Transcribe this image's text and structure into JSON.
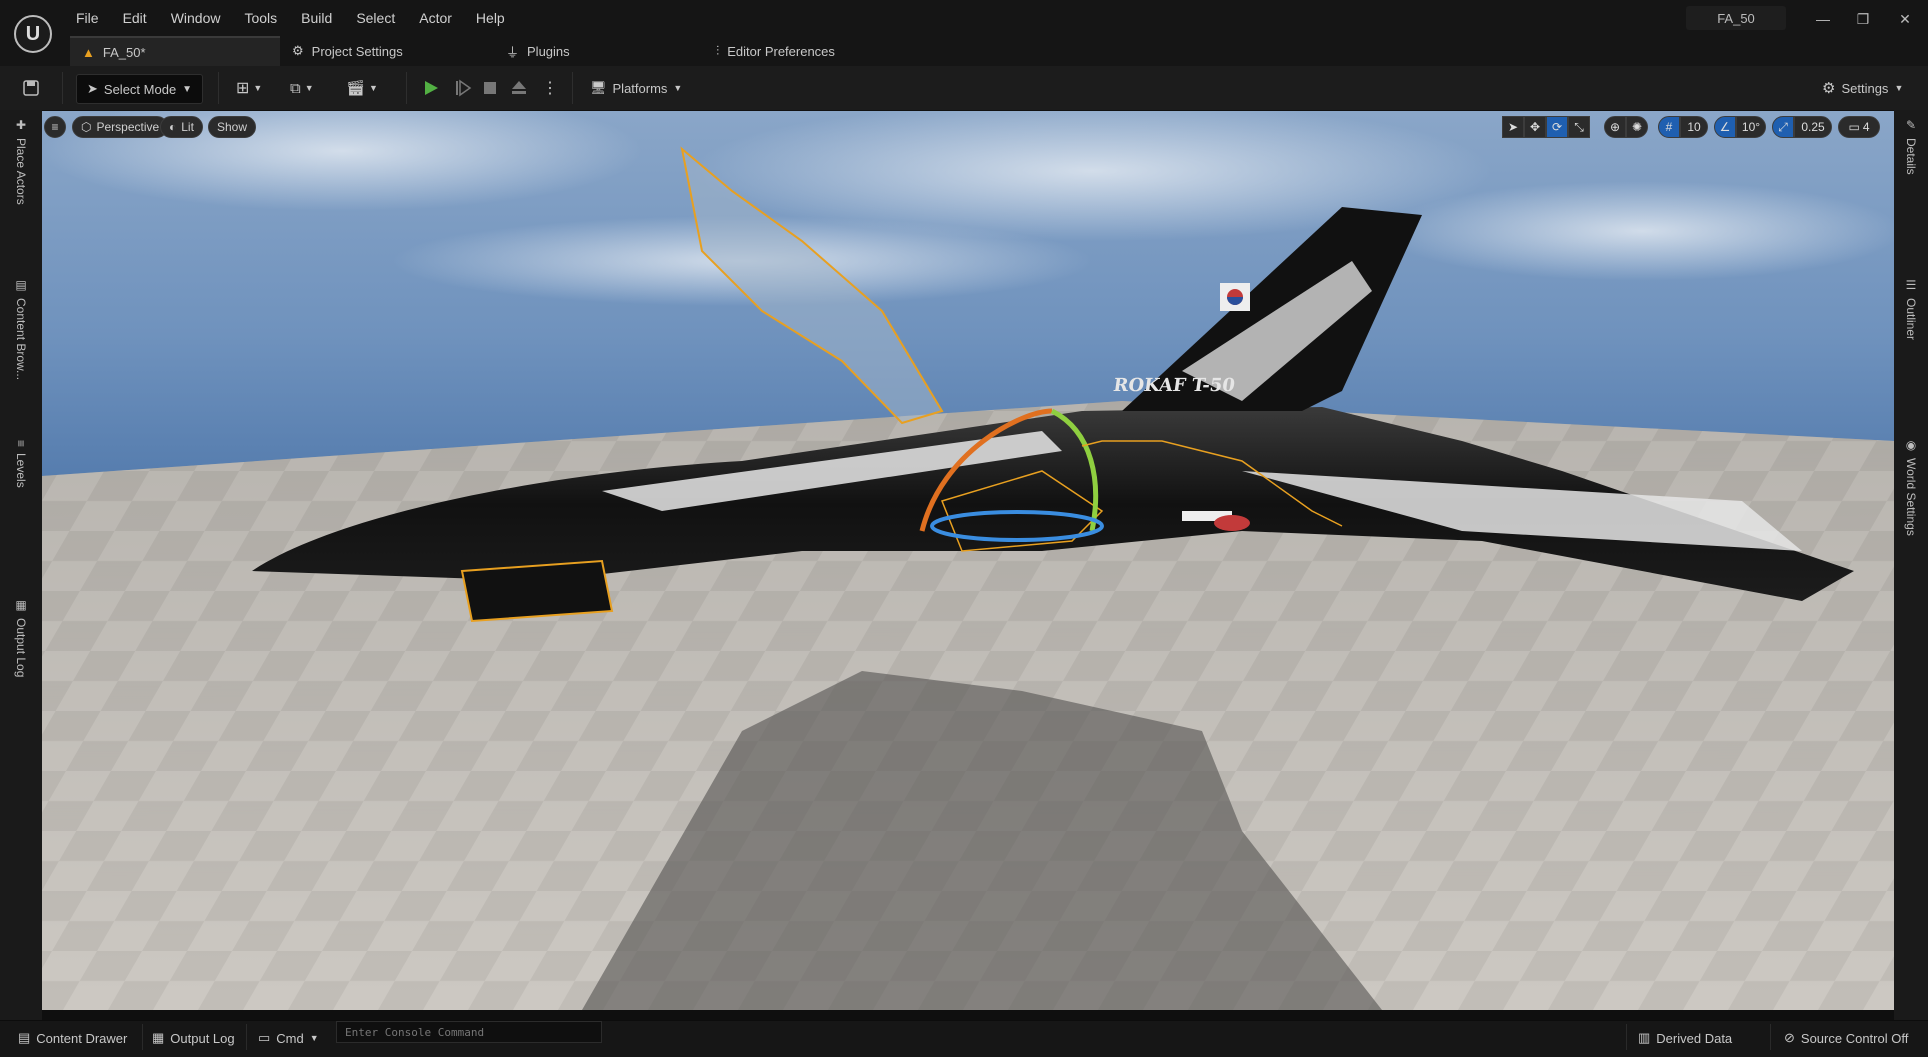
{
  "app": {
    "logo_glyph": "U",
    "project_label": "FA_50"
  },
  "menu": [
    "File",
    "Edit",
    "Window",
    "Tools",
    "Build",
    "Select",
    "Actor",
    "Help"
  ],
  "window_controls": {
    "minimize": "—",
    "restore": "❐",
    "close": "✕"
  },
  "tabs": [
    {
      "label": "FA_50*",
      "icon": "level-warning-icon"
    },
    {
      "label": "Project Settings",
      "icon": "settings-gear-icon"
    },
    {
      "label": "Plugins",
      "icon": "plug-icon"
    },
    {
      "label": "Editor Preferences",
      "icon": "sliders-icon"
    }
  ],
  "toolbar": {
    "select_mode": "Select Mode",
    "platforms": "Platforms",
    "settings": "Settings"
  },
  "left_panels": [
    "Place Actors",
    "Content Brow...",
    "Levels",
    "Output Log"
  ],
  "right_panels": [
    "Details",
    "Outliner",
    "World Settings"
  ],
  "viewport": {
    "perspective": "Perspective",
    "lit": "Lit",
    "show": "Show",
    "grid_snap": "10",
    "rot_snap": "10°",
    "scale_snap": "0.25",
    "cam_speed": "4",
    "scene": {
      "tail_text": "ROKAF T-50"
    }
  },
  "statusbar": {
    "content_drawer": "Content Drawer",
    "output_log": "Output Log",
    "cmd": "Cmd",
    "console_placeholder": "Enter Console Command",
    "derived_data": "Derived Data",
    "source_control": "Source Control Off"
  },
  "colors": {
    "play": "#52b043",
    "accent": "#1f5fb0",
    "selection": "#e8a020",
    "sky": "#6b8fb8"
  }
}
